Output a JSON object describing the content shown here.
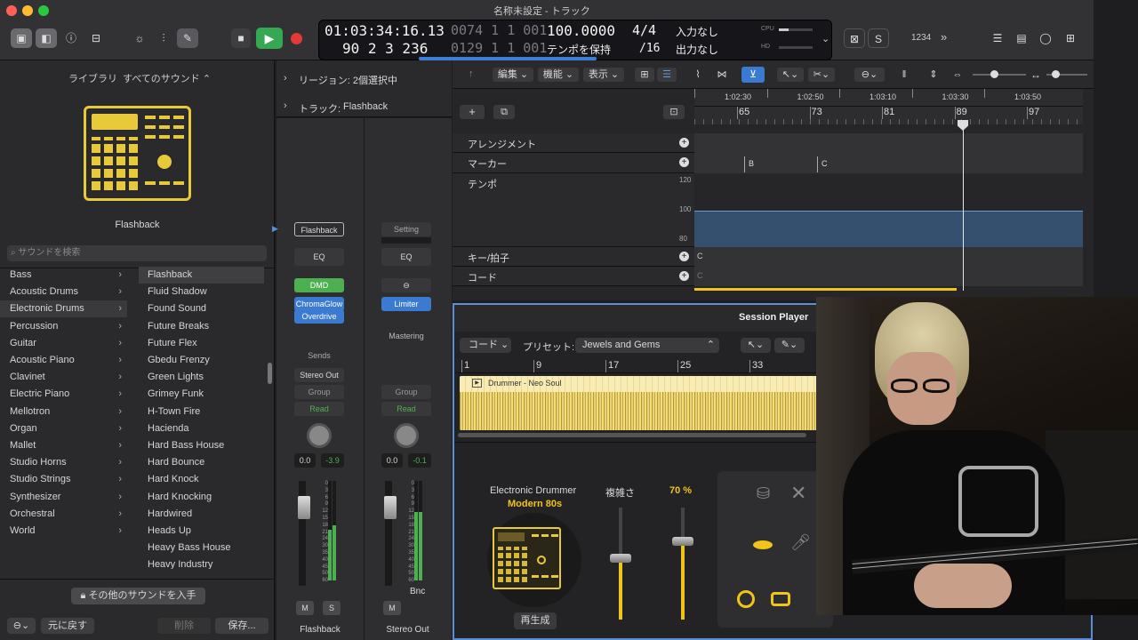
{
  "window": {
    "title": "名称未設定 - トラック"
  },
  "lcd": {
    "time": "01:03:34:16.13",
    "bars": "90  2  3  236",
    "bars_dim": "0074  1  1  001",
    "bars_dim2": "0129  1  1  001",
    "tempo": "100.0000",
    "tempo_mode": "テンポを保持",
    "sig": "4/4",
    "div": "/16",
    "input": "入力なし",
    "output": "出力なし",
    "cpu": "CPU",
    "hd": "HD"
  },
  "toolbar": {
    "count_in": "1234"
  },
  "library": {
    "title": "ライブラリ",
    "filter": "すべてのサウンド ⌃",
    "patch_name": "Flashback",
    "search_placeholder": "サウンドを検索",
    "categories": [
      "Bass",
      "Acoustic Drums",
      "Electronic Drums",
      "Percussion",
      "Guitar",
      "Acoustic Piano",
      "Clavinet",
      "Electric Piano",
      "Mellotron",
      "Organ",
      "Mallet",
      "Studio Horns",
      "Studio Strings",
      "Synthesizer",
      "Orchestral",
      "World"
    ],
    "sounds": [
      "Flashback",
      "Fluid Shadow",
      "Found Sound",
      "Future Breaks",
      "Future Flex",
      "Gbedu Frenzy",
      "Green Lights",
      "Grimey Funk",
      "H-Town Fire",
      "Hacienda",
      "Hard Bass House",
      "Hard Bounce",
      "Hard Knock",
      "Hard Knocking",
      "Hardwired",
      "Heads Up",
      "Heavy Bass House",
      "Heavy Industry"
    ],
    "get_more": "その他のサウンドを入手",
    "revert": "元に戻す",
    "delete": "削除",
    "save": "保存..."
  },
  "inspector": {
    "region_label": "リージョン: 2個選択中",
    "track_label": "トラック:",
    "track_name": "Flashback"
  },
  "mixer": {
    "ch1": {
      "setting": "Flashback",
      "eq": "EQ",
      "p1": "DMD",
      "p2": "ChromaGlow",
      "p3": "Overdrive",
      "sends": "Sends",
      "out": "Stereo Out",
      "group": "Group",
      "auto": "Read",
      "vol": "0.0",
      "pan": "-3.9",
      "m": "M",
      "s": "S",
      "name": "Flashback"
    },
    "ch2": {
      "setting": "Setting",
      "eq": "EQ",
      "p1": "Limiter",
      "mastering": "Mastering",
      "group": "Group",
      "auto": "Read",
      "vol": "0.0",
      "pan": "-0.1",
      "bnc": "Bnc",
      "m": "M",
      "name": "Stereo Out"
    },
    "scale": [
      "0",
      "3",
      "6",
      "9",
      "12",
      "15",
      "18",
      "21",
      "24",
      "30",
      "35",
      "40",
      "45",
      "50",
      "60"
    ]
  },
  "tracks": {
    "menu_edit": "編集",
    "menu_func": "機能",
    "menu_view": "表示",
    "times": [
      "1:02:30",
      "1:02:50",
      "1:03:10",
      "1:03:30",
      "1:03:50"
    ],
    "bars": [
      "65",
      "73",
      "81",
      "89",
      "97"
    ],
    "global": [
      "アレンジメント",
      "マーカー",
      "テンポ",
      "キー/拍子",
      "コード"
    ],
    "markers": [
      "B",
      "C"
    ],
    "tempo_scale": [
      "120",
      "100",
      "80"
    ],
    "key": "C",
    "chord": "C"
  },
  "session": {
    "title": "Session Player",
    "mode": "コード",
    "preset_label": "プリセット:",
    "preset": "Jewels and Gems",
    "bars": [
      "1",
      "9",
      "17",
      "25",
      "33"
    ],
    "region": "Drummer - Neo Soul",
    "instrument": "Electronic Drummer",
    "kit": "Modern 80s",
    "complexity": "複雑さ",
    "loudness": "70 %",
    "complexity_value": 0.55,
    "loudness_value": 0.7,
    "regen": "再生成"
  }
}
